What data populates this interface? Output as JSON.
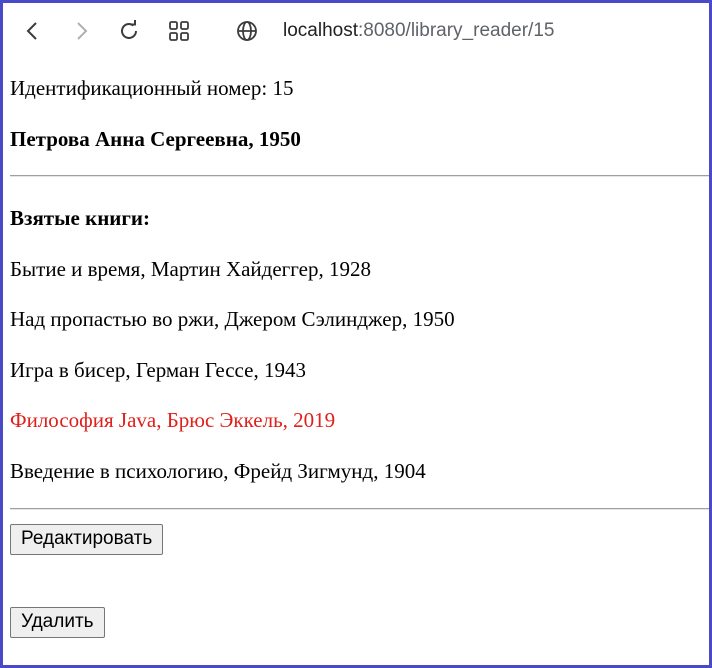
{
  "browser": {
    "url_host": "localhost",
    "url_path": ":8080/library_reader/15"
  },
  "reader": {
    "id_line": "Идентификационный номер: 15",
    "name_line": "Петрова Анна Сергеевна, 1950"
  },
  "books": {
    "heading": "Взятые книги:",
    "items": [
      {
        "text": "Бытие и время, Мартин Хайдеггер, 1928",
        "overdue": false
      },
      {
        "text": "Над пропастью во ржи, Джером Сэлинджер, 1950",
        "overdue": false
      },
      {
        "text": "Игра в бисер, Герман Гессе, 1943",
        "overdue": false
      },
      {
        "text": "Философия Java, Брюс Эккель, 2019",
        "overdue": true
      },
      {
        "text": "Введение в психологию, Фрейд Зигмунд, 1904",
        "overdue": false
      }
    ],
    "highlight_color": "#e0201a"
  },
  "actions": {
    "edit_label": "Редактировать",
    "delete_label": "Удалить"
  }
}
